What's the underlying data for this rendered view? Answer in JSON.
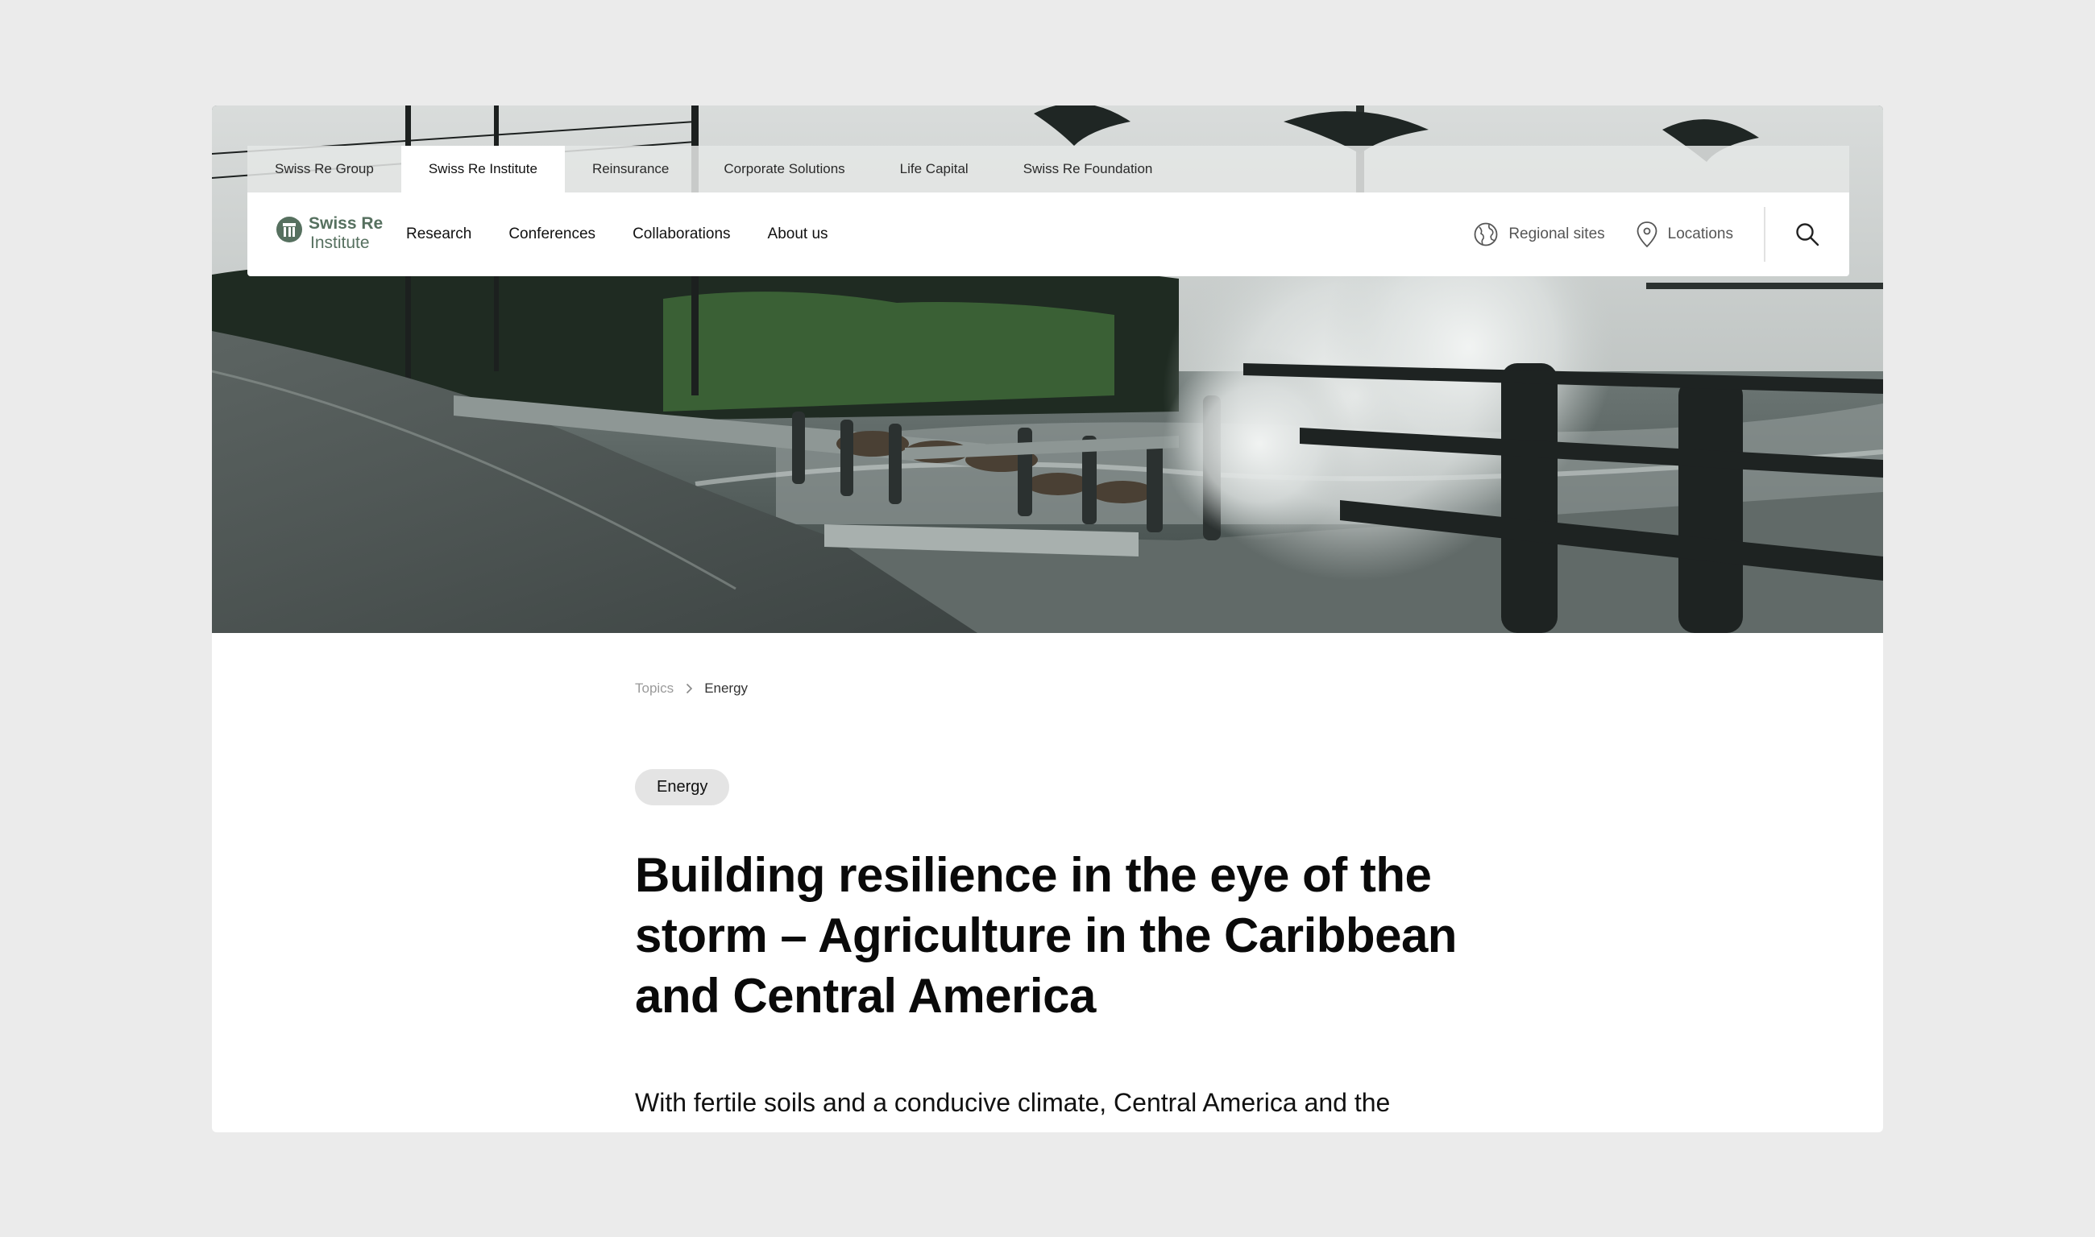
{
  "group_tabs": [
    {
      "label": "Swiss Re Group"
    },
    {
      "label": "Swiss Re Institute"
    },
    {
      "label": "Reinsurance"
    },
    {
      "label": "Corporate Solutions"
    },
    {
      "label": "Life Capital"
    },
    {
      "label": "Swiss Re Foundation"
    }
  ],
  "active_group_tab": "Swiss Re Institute",
  "logo": {
    "line1": "Swiss Re",
    "line2": "Institute"
  },
  "nav": {
    "items": [
      {
        "label": "Research"
      },
      {
        "label": "Conferences"
      },
      {
        "label": "Collaborations"
      },
      {
        "label": "About us"
      }
    ],
    "regional_sites": "Regional sites",
    "locations": "Locations",
    "icons": {
      "regional": "globe-icon",
      "locations": "map-pin-icon",
      "search": "search-icon"
    }
  },
  "breadcrumb": {
    "parent": "Topics",
    "current": "Energy"
  },
  "article": {
    "tag": "Energy",
    "title": "Building resilience in the eye of the storm – Agriculture in the Caribbean and Central America",
    "lead": "With fertile soils and a conducive climate, Central America and the"
  },
  "colors": {
    "background": "#ebebeb",
    "brand_green": "#56705f",
    "tag_bg": "#e4e4e4"
  }
}
